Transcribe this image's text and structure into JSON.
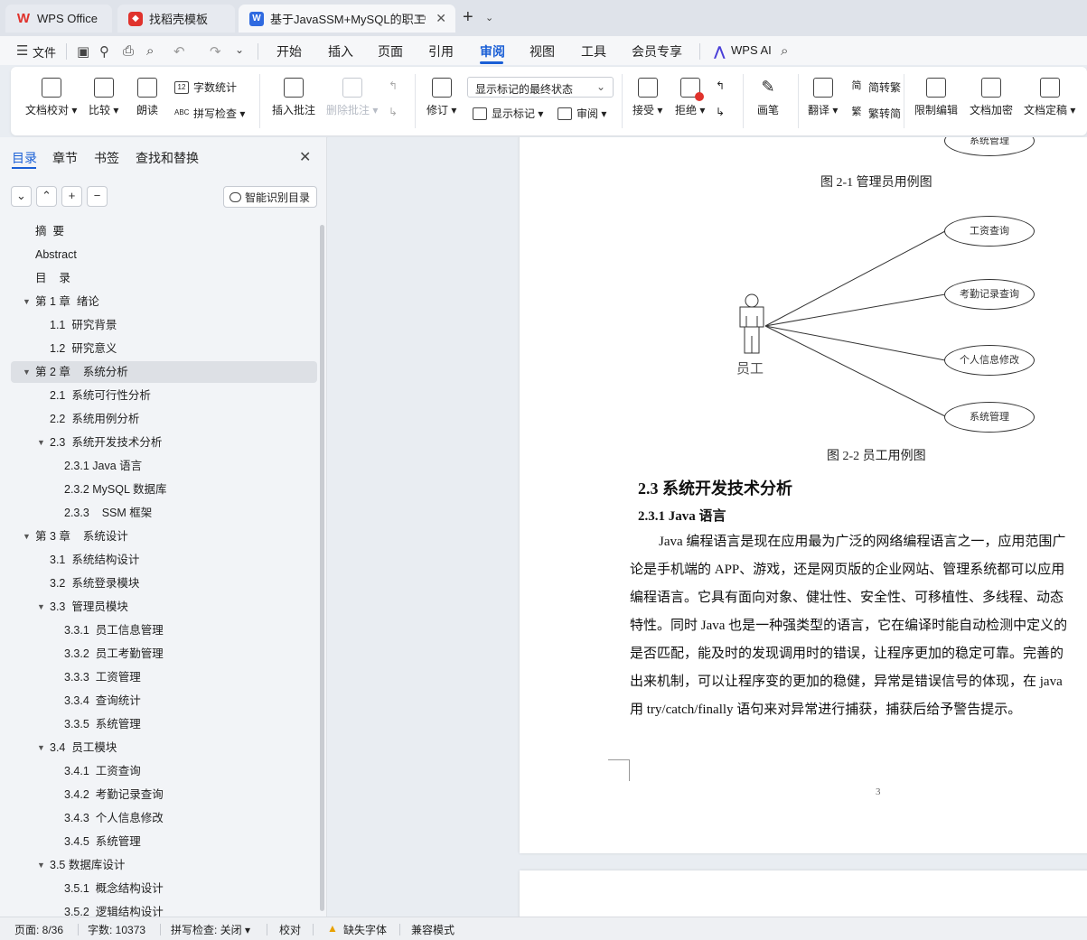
{
  "tabs": [
    {
      "label": "WPS Office",
      "icon": "wps-logo-icon"
    },
    {
      "label": "找稻壳模板",
      "icon": "docer-icon"
    },
    {
      "label": "基于JavaSSM+MySQL的职工",
      "icon": "writer-doc-icon"
    }
  ],
  "menu": {
    "file": "文件",
    "items": [
      "开始",
      "插入",
      "页面",
      "引用",
      "审阅",
      "视图",
      "工具",
      "会员专享"
    ],
    "active": "审阅",
    "wps_ai": "WPS AI"
  },
  "ribbon": {
    "doc_check": "文档校对",
    "compare": "比较",
    "read_aloud": "朗读",
    "word_count": "字数统计",
    "spell_check": "拼写检查",
    "insert_comment": "插入批注",
    "delete_comment": "删除批注",
    "revise": "修订",
    "markup_state": "显示标记的最终状态",
    "show_markup": "显示标记",
    "review_pane": "审阅",
    "accept": "接受",
    "reject": "拒绝",
    "pen": "画笔",
    "translate": "翻译",
    "to_traditional": "简转繁",
    "to_simplified": "繁转简",
    "restrict_edit": "限制编辑",
    "encrypt": "文档加密",
    "finalize": "文档定稿"
  },
  "sidebar": {
    "tabs": [
      "目录",
      "章节",
      "书签",
      "查找和替换"
    ],
    "smart_toc": "智能识别目录",
    "toc": [
      {
        "label": "摘  要",
        "level": 1,
        "arrow": ""
      },
      {
        "label": "Abstract",
        "level": 1,
        "arrow": ""
      },
      {
        "label": "目    录",
        "level": 1,
        "arrow": ""
      },
      {
        "label": "第 1 章  绪论",
        "level": 1,
        "arrow": "▼"
      },
      {
        "label": "1.1  研究背景",
        "level": 2,
        "arrow": ""
      },
      {
        "label": "1.2  研究意义",
        "level": 2,
        "arrow": ""
      },
      {
        "label": "第 2 章    系统分析",
        "level": 1,
        "arrow": "▼",
        "selected": true
      },
      {
        "label": "2.1  系统可行性分析",
        "level": 2,
        "arrow": ""
      },
      {
        "label": "2.2  系统用例分析",
        "level": 2,
        "arrow": ""
      },
      {
        "label": "2.3  系统开发技术分析",
        "level": 2,
        "arrow": "▼"
      },
      {
        "label": "2.3.1 Java 语言",
        "level": 3,
        "arrow": ""
      },
      {
        "label": "2.3.2 MySQL 数据库",
        "level": 3,
        "arrow": ""
      },
      {
        "label": "2.3.3    SSM 框架",
        "level": 3,
        "arrow": ""
      },
      {
        "label": "第 3 章    系统设计",
        "level": 1,
        "arrow": "▼"
      },
      {
        "label": "3.1  系统结构设计",
        "level": 2,
        "arrow": ""
      },
      {
        "label": "3.2  系统登录模块",
        "level": 2,
        "arrow": ""
      },
      {
        "label": "3.3  管理员模块",
        "level": 2,
        "arrow": "▼"
      },
      {
        "label": "3.3.1  员工信息管理",
        "level": 3,
        "arrow": ""
      },
      {
        "label": "3.3.2  员工考勤管理",
        "level": 3,
        "arrow": ""
      },
      {
        "label": "3.3.3  工资管理",
        "level": 3,
        "arrow": ""
      },
      {
        "label": "3.3.4  查询统计",
        "level": 3,
        "arrow": ""
      },
      {
        "label": "3.3.5  系统管理",
        "level": 3,
        "arrow": ""
      },
      {
        "label": "3.4  员工模块",
        "level": 2,
        "arrow": "▼"
      },
      {
        "label": "3.4.1  工资查询",
        "level": 3,
        "arrow": ""
      },
      {
        "label": "3.4.2  考勤记录查询",
        "level": 3,
        "arrow": ""
      },
      {
        "label": "3.4.3  个人信息修改",
        "level": 3,
        "arrow": ""
      },
      {
        "label": "3.4.5  系统管理",
        "level": 3,
        "arrow": ""
      },
      {
        "label": "3.5 数据库设计",
        "level": 2,
        "arrow": "▼"
      },
      {
        "label": "3.5.1  概念结构设计",
        "level": 3,
        "arrow": ""
      },
      {
        "label": "3.5.2  逻辑结构设计",
        "level": 3,
        "arrow": ""
      }
    ]
  },
  "document": {
    "top_usecase": "系统管理",
    "fig1_caption": "图 2-1  管理员用例图",
    "actor": "员工",
    "usecases": [
      "工资查询",
      "考勤记录查询",
      "个人信息修改",
      "系统管理"
    ],
    "fig2_caption": "图 2-2  员工用例图",
    "h2": "2.3  系统开发技术分析",
    "h3": "2.3.1 Java 语言",
    "lines": [
      "Java 编程语言是现在应用最为广泛的网络编程语言之一，应用范围广",
      "论是手机端的 APP、游戏，还是网页版的企业网站、管理系统都可以应用",
      "编程语言。它具有面向对象、健壮性、安全性、可移植性、多线程、动态",
      "特性。同时 Java 也是一种强类型的语言，它在编译时能自动检测中定义的",
      "是否匹配，能及时的发现调用时的错误，让程序更加的稳定可靠。完善的",
      "出来机制，可以让程序变的更加的稳健，异常是错误信号的体现，在 java",
      "用 try/catch/finally 语句来对异常进行捕获，捕获后给予警告提示。"
    ],
    "page_number": "3"
  },
  "status": {
    "page": "页面: 8/36",
    "words": "字数: 10373",
    "spell": "拼写检查: 关闭",
    "proof": "校对",
    "missing_font": "缺失字体",
    "compat": "兼容模式"
  },
  "colors": {
    "accent": "#1a5fd6",
    "wps_red": "#e0322c",
    "writer_blue": "#2f6ae0"
  }
}
